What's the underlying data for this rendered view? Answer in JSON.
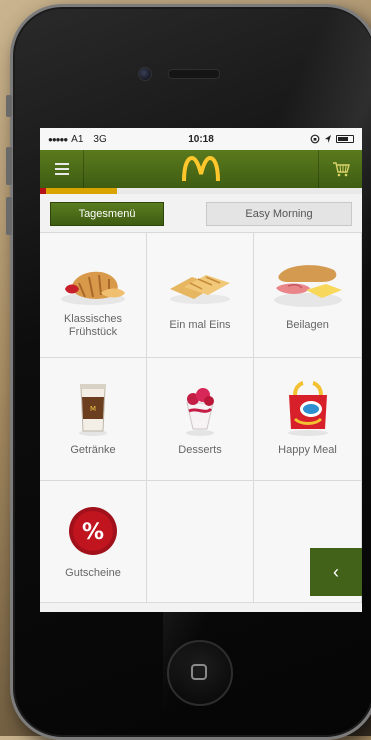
{
  "status_bar": {
    "signal_dots": "●●●●●",
    "carrier": "A1",
    "network": "3G",
    "time": "10:18"
  },
  "header": {
    "brand": "McDonald's",
    "progress_fraction": 0.24
  },
  "tabs": [
    {
      "label": "Tagesmenü",
      "active": true
    },
    {
      "label": "Easy Morning",
      "active": false
    }
  ],
  "grid": {
    "items": [
      {
        "label": "Klassisches Frühstück",
        "icon": "breakfast-croissant-icon"
      },
      {
        "label": "Ein mal Eins",
        "icon": "toast-sandwich-icon"
      },
      {
        "label": "Beilagen",
        "icon": "side-dishes-icon"
      },
      {
        "label": "Getränke",
        "icon": "coffee-cup-icon"
      },
      {
        "label": "Desserts",
        "icon": "sundae-dessert-icon"
      },
      {
        "label": "Happy Meal",
        "icon": "happy-meal-box-icon"
      },
      {
        "label": "Gutscheine",
        "icon": "percent-coupon-icon"
      }
    ]
  },
  "colors": {
    "brand_green": "#4a6b17",
    "brand_yellow": "#ffc72c",
    "coupon_red": "#b5121b"
  }
}
